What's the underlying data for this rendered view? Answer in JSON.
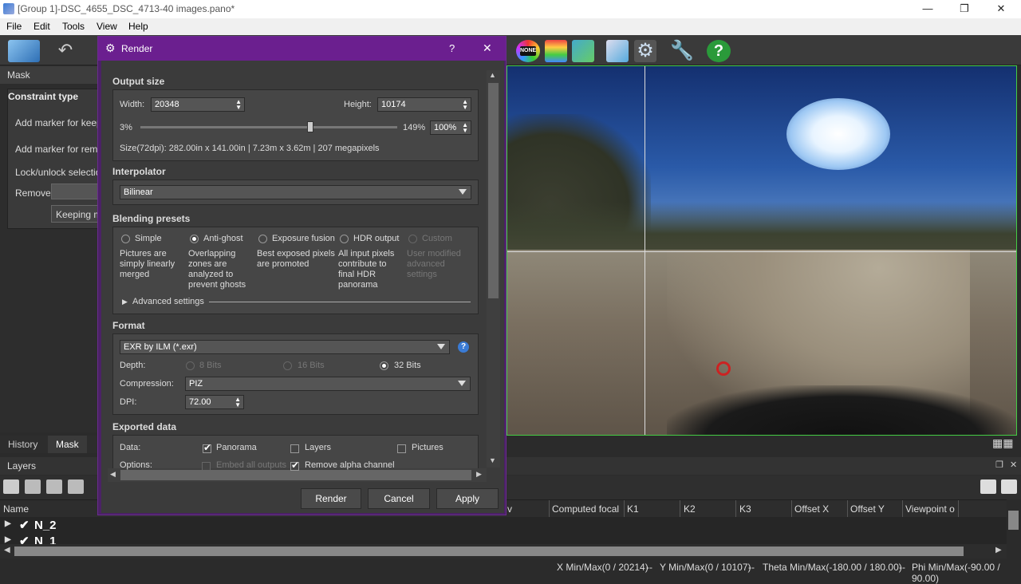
{
  "window": {
    "title": "[Group 1]-DSC_4655_DSC_4713-40 images.pano*",
    "minimize_label": "—",
    "restore_label": "❐",
    "close_label": "✕"
  },
  "menu": {
    "file": "File",
    "edit": "Edit",
    "tools": "Tools",
    "view": "View",
    "help": "Help"
  },
  "toolbar": {
    "none_icon_label": "NONE"
  },
  "left_panel": {
    "header": "Mask",
    "constraint_title": "Constraint type",
    "add_keep": "Add marker for keeping",
    "add_remove": "Add marker for removing",
    "lock": "Lock/unlock selection",
    "remove_label": "Remove",
    "keeping_button": "Keeping markers"
  },
  "bottom_tabs": {
    "history": "History",
    "mask": "Mask"
  },
  "layers": {
    "title": "Layers",
    "columns": [
      "Name",
      "v",
      "Computed focal",
      "K1",
      "K2",
      "K3",
      "Offset X",
      "Offset Y",
      "Viewpoint o"
    ],
    "rows": [
      "N_2",
      "N_1"
    ]
  },
  "status": {
    "xminmax": "X Min/Max(0 / 20214)",
    "yminmax": "Y Min/Max(0 / 10107)",
    "theta": "Theta Min/Max(-180.00 / 180.00)",
    "phi": "Phi Min/Max(-90.00 / 90.00)",
    "sep": "--"
  },
  "dialog": {
    "title": "Render",
    "help": "?",
    "close": "✕",
    "output_size": {
      "title": "Output size",
      "width_label": "Width:",
      "width_value": "20348",
      "height_label": "Height:",
      "height_value": "10174",
      "min_pct": "3%",
      "max_pct": "149%",
      "pct_value": "100%",
      "slider_fraction": 0.66,
      "size_text": "Size(72dpi): 282.00in x 141.00in  |  7.23m x  3.62m  |  207 megapixels"
    },
    "interpolator": {
      "title": "Interpolator",
      "value": "Bilinear"
    },
    "blending": {
      "title": "Blending presets",
      "options": [
        {
          "label": "Simple",
          "desc": [
            "Pictures are",
            "simply linearly",
            "merged"
          ],
          "selected": false,
          "disabled": false
        },
        {
          "label": "Anti-ghost",
          "desc": [
            "Overlapping",
            "zones are",
            "analyzed to",
            "prevent ghosts"
          ],
          "selected": true,
          "disabled": false
        },
        {
          "label": "Exposure fusion",
          "desc": [
            "Best exposed pixels",
            "are promoted"
          ],
          "selected": false,
          "disabled": false
        },
        {
          "label": "HDR output",
          "desc": [
            "All input pixels",
            "contribute to",
            "final HDR",
            "panorama"
          ],
          "selected": false,
          "disabled": false
        },
        {
          "label": "Custom",
          "desc": [
            "User modified",
            "advanced",
            "settings"
          ],
          "selected": false,
          "disabled": true
        }
      ],
      "advanced": "Advanced settings"
    },
    "format": {
      "title": "Format",
      "value": "EXR by ILM (*.exr)",
      "depth_label": "Depth:",
      "depth_options": [
        "8 Bits",
        "16 Bits",
        "32 Bits"
      ],
      "depth_selected": "32 Bits",
      "compression_label": "Compression:",
      "compression_value": "PIZ",
      "dpi_label": "DPI:",
      "dpi_value": "72.00"
    },
    "exported": {
      "title": "Exported data",
      "data_label": "Data:",
      "panorama": "Panorama",
      "layers": "Layers",
      "pictures": "Pictures",
      "options_label": "Options:",
      "embed": "Embed all outputs",
      "remove_alpha": "Remove alpha channel"
    },
    "buttons": {
      "render": "Render",
      "cancel": "Cancel",
      "apply": "Apply"
    }
  }
}
